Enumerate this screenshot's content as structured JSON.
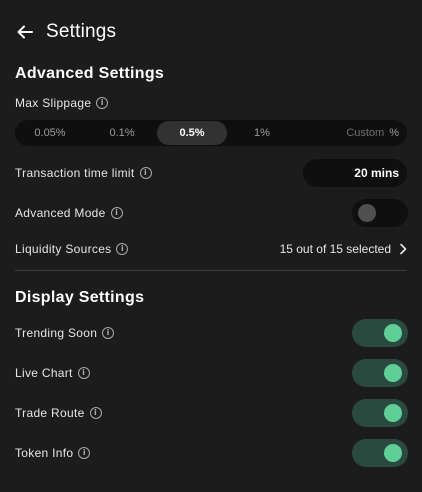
{
  "header": {
    "title": "Settings",
    "back_icon": "arrow-left-icon"
  },
  "advanced": {
    "title": "Advanced Settings",
    "max_slippage": {
      "label": "Max Slippage",
      "options": [
        "0.05%",
        "0.1%",
        "0.5%",
        "1%"
      ],
      "selected": "0.5%",
      "custom_placeholder": "Custom",
      "custom_unit": "%"
    },
    "time_limit": {
      "label": "Transaction time limit",
      "value": "20 mins"
    },
    "advanced_mode": {
      "label": "Advanced Mode",
      "enabled": false
    },
    "liquidity": {
      "label": "Liquidity Sources",
      "value": "15 out of 15 selected"
    }
  },
  "display": {
    "title": "Display Settings",
    "toggles": [
      {
        "label": "Trending Soon",
        "enabled": true
      },
      {
        "label": "Live Chart",
        "enabled": true
      },
      {
        "label": "Trade Route",
        "enabled": true
      },
      {
        "label": "Token Info",
        "enabled": true
      }
    ]
  },
  "colors": {
    "background": "#1c1c1c",
    "toggle_on_track": "#2b4a3f",
    "toggle_on_knob": "#5fcf97",
    "toggle_off_knob": "#4f4f4f"
  }
}
